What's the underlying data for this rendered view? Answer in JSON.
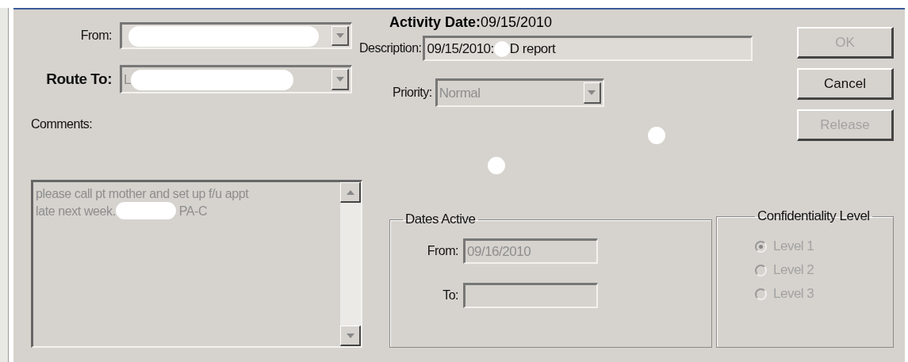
{
  "dialog": {
    "from": {
      "label": "From:",
      "redacted": true
    },
    "route_to": {
      "label": "Route To:",
      "value": "L",
      "redacted": true,
      "disabled": true
    },
    "comments": {
      "label": "Comments:",
      "lines": [
        "please call pt mother and set up f/u appt",
        "late next week."
      ],
      "signature": "PA-C",
      "redacted": true,
      "disabled": true
    },
    "activity_date": {
      "label": "Activity Date:",
      "value": "09/15/2010"
    },
    "description": {
      "label": "Description:",
      "value": "09/15/2010:",
      "value_end": "D report",
      "redacted": true
    },
    "priority": {
      "label": "Priority:",
      "value": "Normal",
      "disabled": true
    },
    "buttons": [
      {
        "label": "OK",
        "disabled": true
      },
      {
        "label": "Cancel",
        "disabled": false
      },
      {
        "label": "Release",
        "disabled": true
      }
    ],
    "dates_active": {
      "title": "Dates Active",
      "from": {
        "label": "From:",
        "value": "09/16/2010",
        "disabled": true
      },
      "to": {
        "label": "To:"
      }
    },
    "confidentiality": {
      "title": "Confidentiality Level",
      "options": [
        {
          "label": "Level 1",
          "selected": true,
          "disabled": true
        },
        {
          "label": "Level 2",
          "selected": false,
          "disabled": true
        },
        {
          "label": "Level 3",
          "selected": false,
          "disabled": true
        }
      ]
    }
  }
}
